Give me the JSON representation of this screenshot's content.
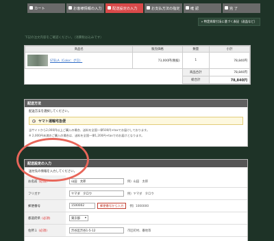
{
  "steps": [
    {
      "label": "カート",
      "active": false
    },
    {
      "label": "お客様情報の入力",
      "active": false
    },
    {
      "label": "配送設定の入力",
      "active": true
    },
    {
      "label": "お支払方法の指定",
      "active": false
    },
    {
      "label": "確 認",
      "active": false
    },
    {
      "label": "完 了",
      "active": false
    }
  ],
  "pdf_link": "» 特定商取引法に基づく表記（返品など）",
  "intro": "下記の注文内容をご確認ください。（消費税は込みです）",
  "cart": {
    "headers": [
      "商品名",
      "販売価格",
      "数量",
      "小計"
    ],
    "item": {
      "name": "STELA（Color：グロ）",
      "price": "73,000円(税抜)",
      "qty": "1",
      "subtotal": "78,840円"
    },
    "subtotal_label": "商品合計",
    "subtotal_value": "78,840円",
    "total_label": "総合計",
    "total_value": "78,840円"
  },
  "shipping": {
    "title": "配送方法",
    "desc": "配送方法を選択してください。",
    "option": "ヤマト運輸宅急便",
    "note1": "当サイトから2,000円以上ご購入の場合、送料を全国一律500円+taxでお届けしております。",
    "note2": "※ 2,000円未満のご購入の場合は、送料を全国一律1,200円+taxでのお届けとなります。"
  },
  "address": {
    "title": "配送設定の入力",
    "desc": "送付先の情報を入力してください。",
    "rows": [
      {
        "label": "お名前",
        "required": "(必須)",
        "value": "山田　太郎",
        "example": "例）山田　太郎"
      },
      {
        "label": "フリガナ",
        "required": "",
        "value": "ヤマダ　タロウ",
        "example": "例）ヤマダ　タロウ"
      },
      {
        "label": "郵便番号",
        "required": "",
        "value": "1500002",
        "button": "郵便番号から入力",
        "example": "例）1000000"
      },
      {
        "label": "都道府県",
        "required": "(必須)",
        "value": "東京都"
      },
      {
        "label": "住所１",
        "required": "(必須)",
        "value": "渋谷区渋谷1-5-12",
        "example": "市区町村、番地等"
      }
    ]
  },
  "colors": {
    "accent": "#d94a4a",
    "background": "#1e3327",
    "annotation": "#e8665a"
  }
}
